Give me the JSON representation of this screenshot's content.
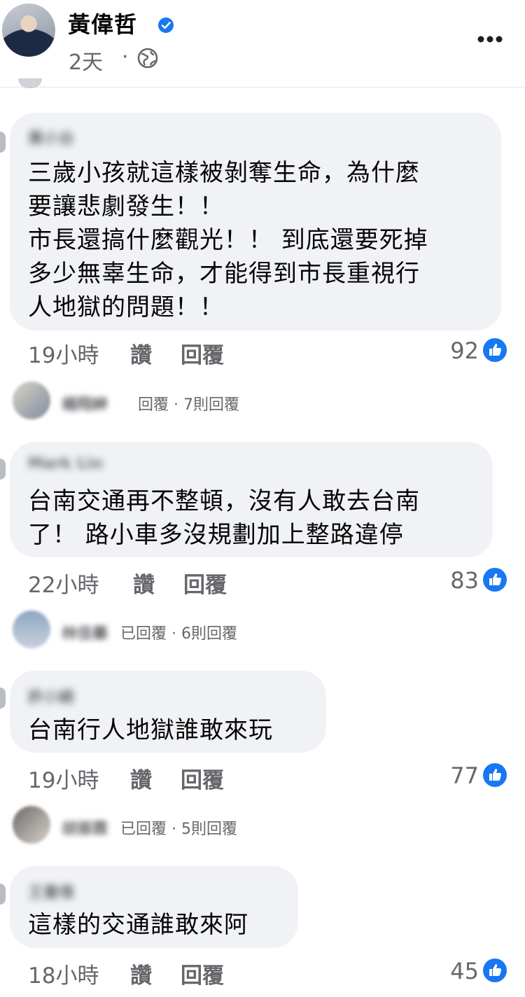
{
  "header": {
    "page_name": "黃偉哲",
    "time": "2天",
    "dot": "·",
    "icons": [
      "verified-icon",
      "globe-icon",
      "more-icon"
    ]
  },
  "comments": [
    {
      "author": "黃小台",
      "lines": [
        "三歲小孩就這樣被剝奪生命，為什麼",
        "要讓悲劇發生！！",
        "市長還搞什麼觀光！！ 到底還要死掉",
        "多少無辜生命，才能得到市長重視行",
        "人地獄的問題！！"
      ],
      "time": "19小時",
      "like_label": "讚",
      "reply_label": "回覆",
      "reactions": "92",
      "reply_row": {
        "name": "楊翔紳",
        "text": "回覆 · 7則回覆"
      }
    },
    {
      "author": "Mark Lin",
      "lines": [
        "台南交通再不整頓，沒有人敢去台南",
        "了！ 路小車多沒規劃加上整路違停"
      ],
      "time": "22小時",
      "like_label": "讚",
      "reply_label": "回覆",
      "reactions": "83",
      "reply_row": {
        "name": "林佳蓁",
        "text": "已回覆 · 6則回覆"
      }
    },
    {
      "author": "許小綺",
      "lines": [
        "台南行人地獄誰敢來玩"
      ],
      "time": "19小時",
      "like_label": "讚",
      "reply_label": "回覆",
      "reactions": "77",
      "reply_row": {
        "name": "胡振霖",
        "text": "已回覆 · 5則回覆"
      }
    },
    {
      "author": "王書偉",
      "lines": [
        "這樣的交通誰敢來阿"
      ],
      "time": "18小時",
      "like_label": "讚",
      "reply_label": "回覆",
      "reactions": "45"
    }
  ],
  "colors": {
    "accent": "#1877f2",
    "bubble": "#f0f2f5",
    "meta": "#65676b"
  }
}
